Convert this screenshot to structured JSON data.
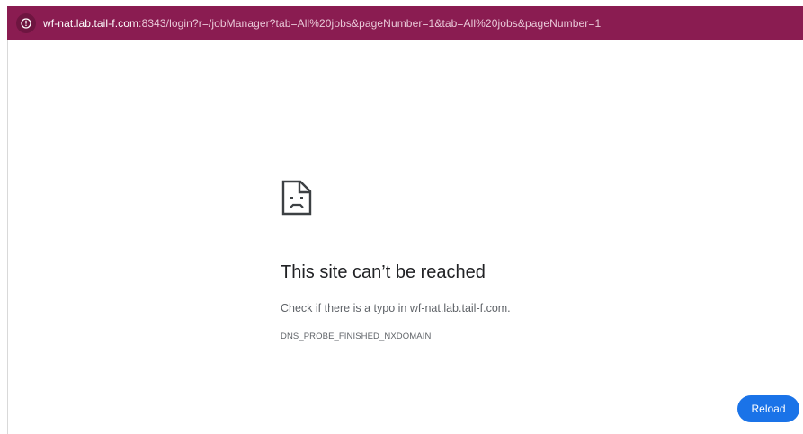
{
  "address_bar": {
    "host": "wf-nat.lab.tail-f.com",
    "path": ":8343/login?r=/jobManager?tab=All%20jobs&pageNumber=1&tab=All%20jobs&pageNumber=1",
    "info_icon": "info-icon",
    "background_color": "#8a1c51"
  },
  "error_page": {
    "icon": "sad-file-icon",
    "title": "This site can’t be reached",
    "message": "Check if there is a typo in wf-nat.lab.tail-f.com.",
    "error_code": "DNS_PROBE_FINISHED_NXDOMAIN"
  },
  "actions": {
    "reload_label": "Reload",
    "reload_color": "#1a73e8"
  }
}
